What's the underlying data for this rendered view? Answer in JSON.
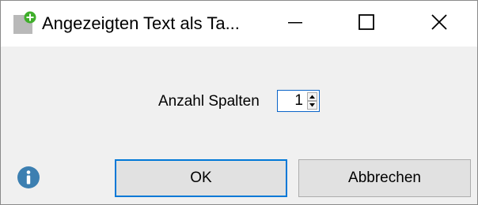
{
  "window": {
    "title": "Angezeigten Text als Ta...",
    "app_icon": "table-plus-icon",
    "controls": {
      "minimize_icon": "minimize-icon",
      "maximize_icon": "maximize-icon",
      "close_icon": "close-icon"
    }
  },
  "form": {
    "columns_label": "Anzahl Spalten",
    "columns_value": "1"
  },
  "footer": {
    "info_icon": "info-icon",
    "ok_label": "OK",
    "cancel_label": "Abbrechen"
  },
  "colors": {
    "accent": "#0078d7",
    "info_blue": "#3c7fb1",
    "icon_green": "#3fae2a",
    "button_face": "#e1e1e1",
    "dialog_bg": "#f0f0f0"
  }
}
